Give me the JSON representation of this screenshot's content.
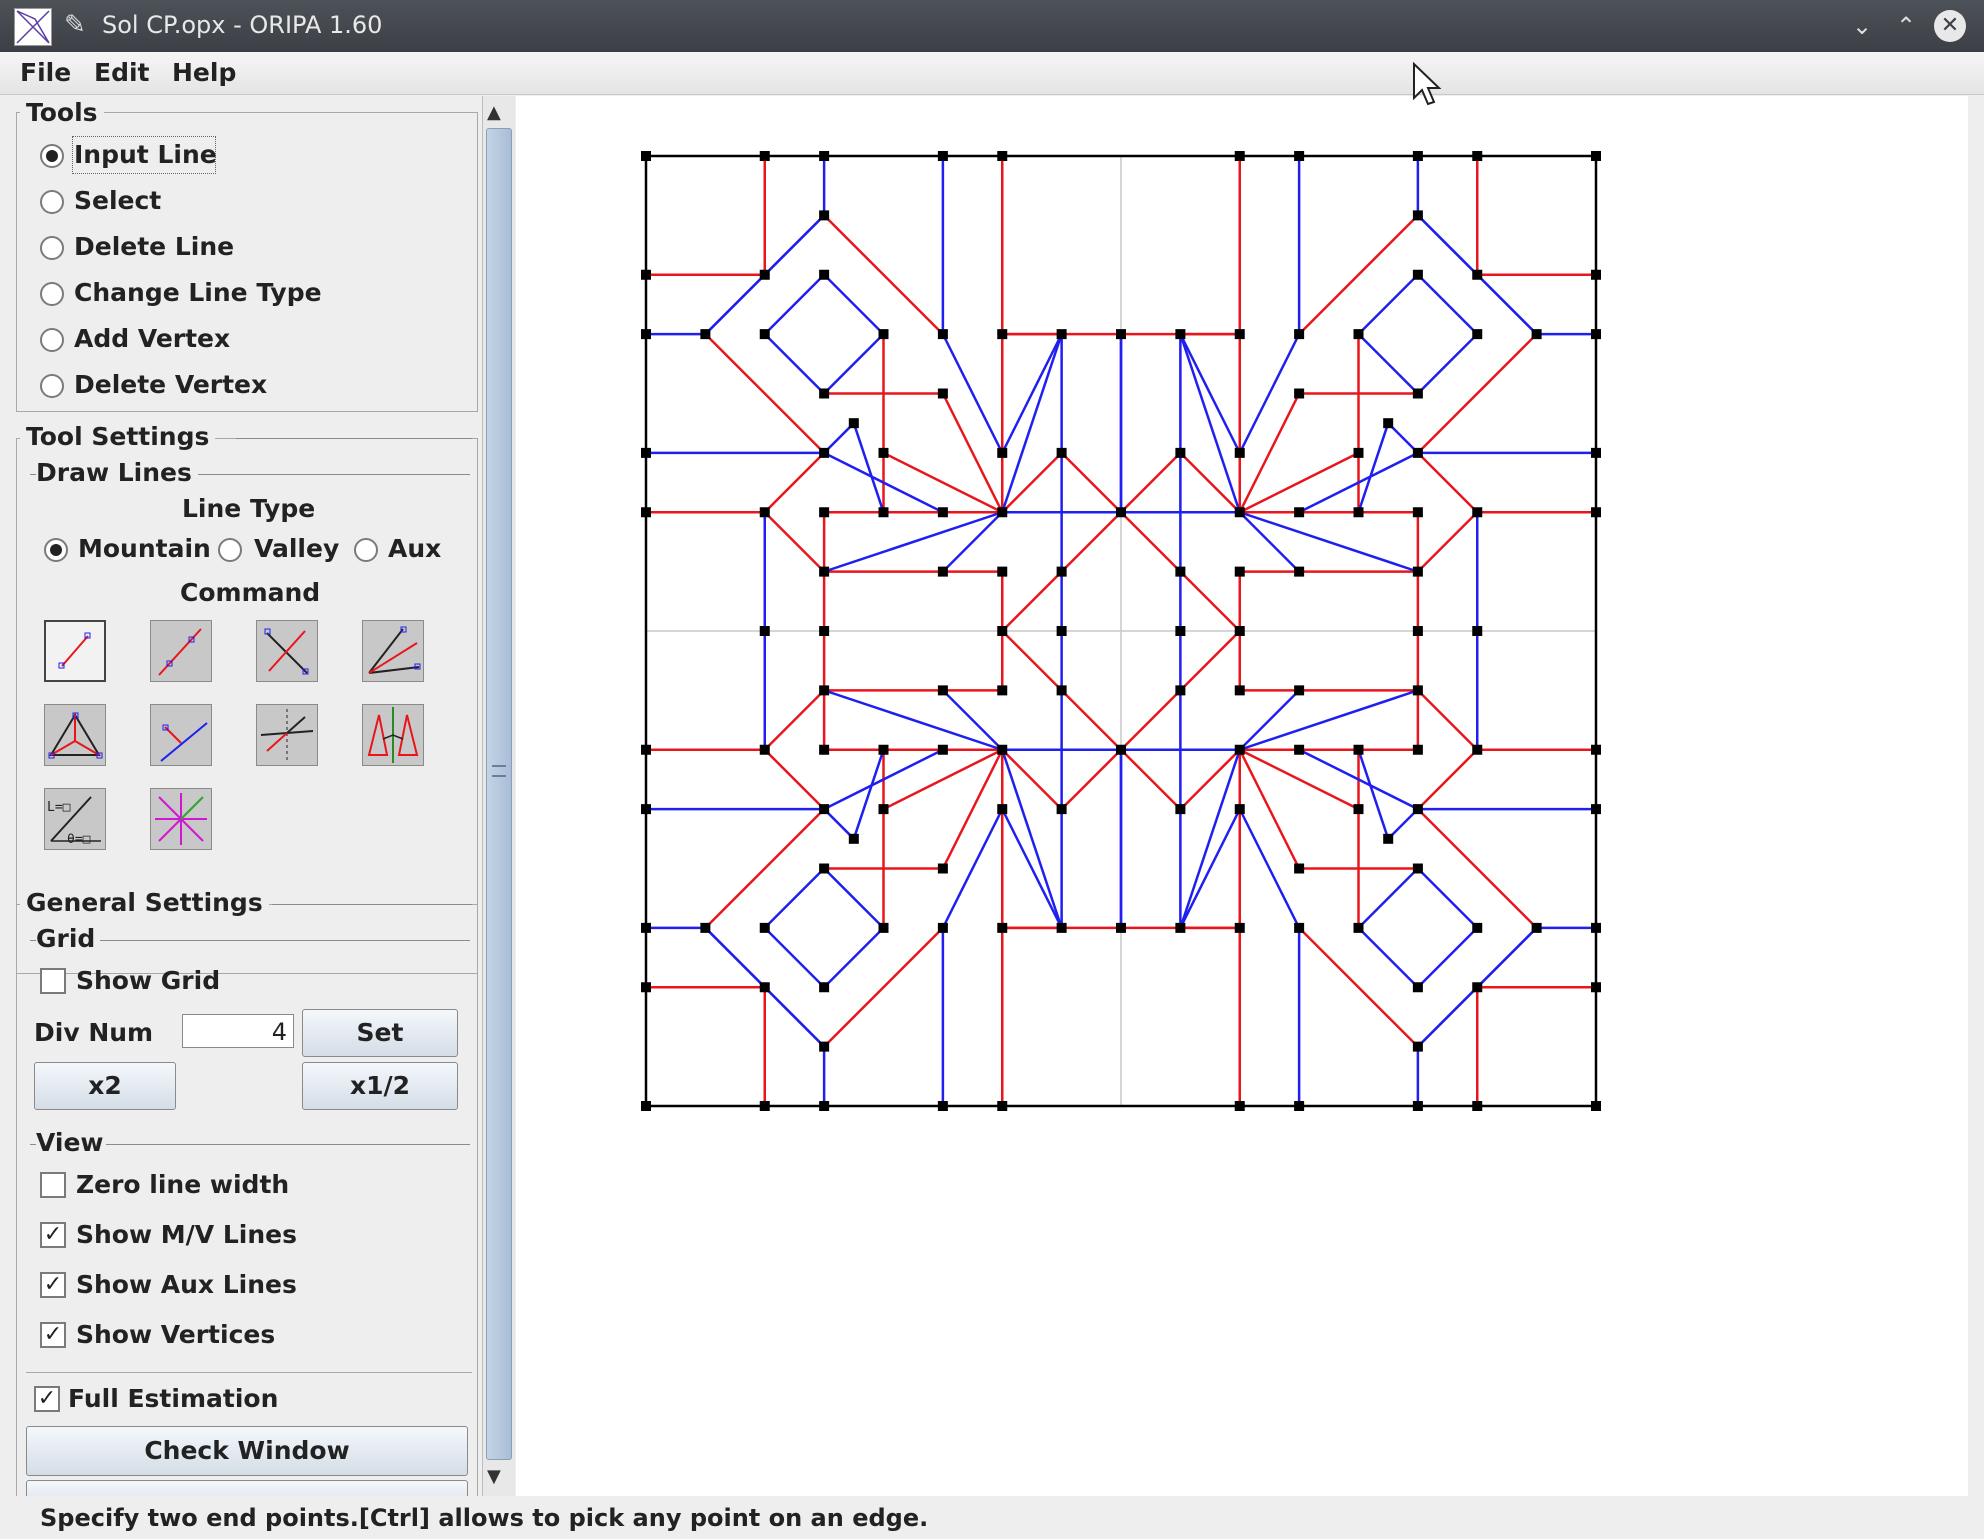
{
  "window": {
    "title": "Sol CP.opx - ORIPA 1.60",
    "minimize": "⌄",
    "maximize": "⌃",
    "close": "✕"
  },
  "menu": {
    "file": "File",
    "edit": "Edit",
    "help": "Help"
  },
  "tools": {
    "title": "Tools",
    "options": [
      "Input Line",
      "Select",
      "Delete Line",
      "Change Line Type",
      "Add Vertex",
      "Delete Vertex"
    ],
    "selected": "Input Line"
  },
  "tool_settings": {
    "title": "Tool Settings",
    "subtitle": "Draw Lines",
    "line_type_label": "Line Type",
    "line_types": [
      "Mountain",
      "Valley",
      "Aux"
    ],
    "selected_line_type": "Mountain",
    "command_label": "Command",
    "commands": [
      "line-by-two-points-icon",
      "line-segment-icon",
      "perpendicular-bisector-icon",
      "angle-bisector-icon",
      "triangle-incenter-icon",
      "perpendicular-line-icon",
      "symmetric-line-icon",
      "mirror-copy-icon",
      "length-angle-icon",
      "radial-lines-icon"
    ]
  },
  "general_settings": {
    "title": "General Settings",
    "grid_label": "Grid",
    "show_grid_label": "Show Grid",
    "show_grid": false,
    "div_num_label": "Div Num",
    "div_num_value": "4",
    "set_label": "Set",
    "x2_label": "x2",
    "half_label": "x1/2",
    "view_label": "View",
    "zero_line_width_label": "Zero line width",
    "zero_line_width": false,
    "show_mv_label": "Show M/V Lines",
    "show_mv": true,
    "show_aux_label": "Show Aux Lines",
    "show_aux": true,
    "show_vertices_label": "Show Vertices",
    "show_vertices": true,
    "full_estimation_label": "Full Estimation",
    "full_estimation": true,
    "check_window_label": "Check Window"
  },
  "status": "Specify two end points.[Ctrl] allows to pick any point on an edge.",
  "colors": {
    "mountain": "#e8161c",
    "valley": "#1f1ff0",
    "aux": "#c8c8c8",
    "cut": "#000000"
  }
}
